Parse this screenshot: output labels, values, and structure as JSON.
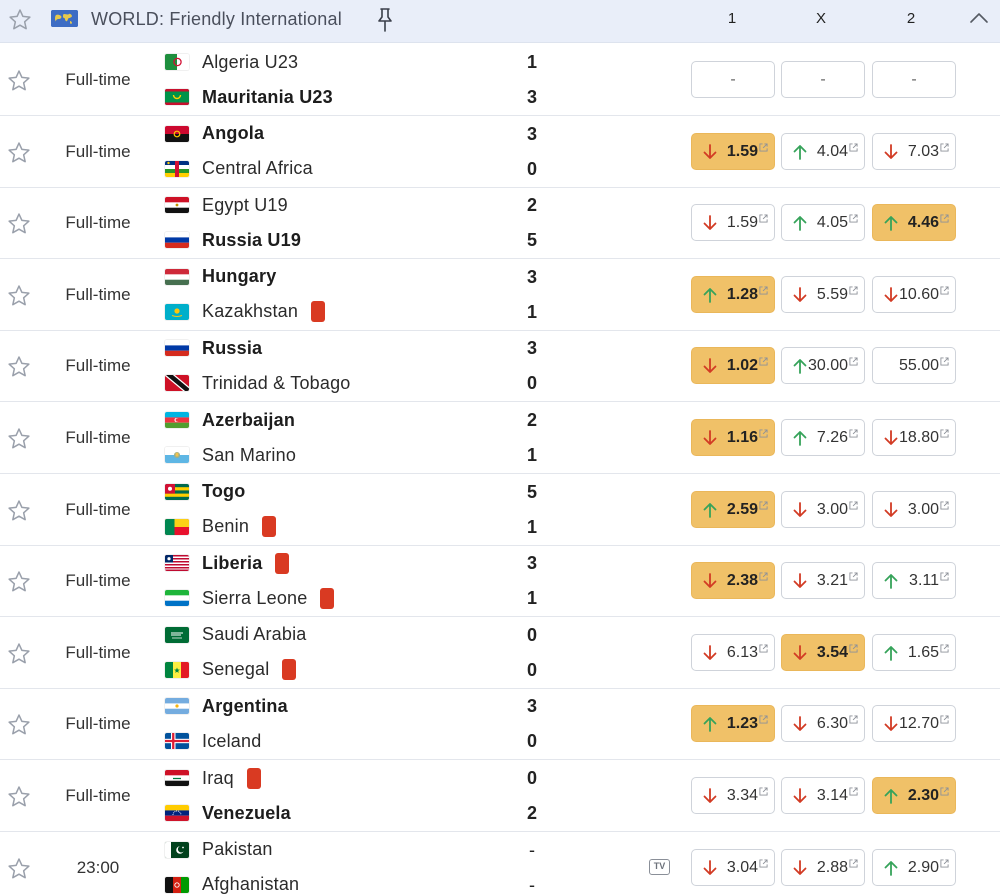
{
  "header": {
    "league": "WORLD: Friendly International",
    "col1": "1",
    "colX": "X",
    "col2": "2"
  },
  "colors": {
    "highlight": "#f0c168",
    "up": "#36a35a",
    "down": "#d23b24",
    "red_card": "#d93a22"
  },
  "matches": [
    {
      "status": "Full-time",
      "home": {
        "name": "Algeria U23",
        "flag": "algeria",
        "score": "1",
        "bold": false,
        "red_card": false
      },
      "away": {
        "name": "Mauritania U23",
        "flag": "mauritania",
        "score": "3",
        "bold": true,
        "red_card": false
      },
      "odds": [
        {
          "value": "-",
          "trend": "none",
          "highlight": false
        },
        {
          "value": "-",
          "trend": "none",
          "highlight": false
        },
        {
          "value": "-",
          "trend": "none",
          "highlight": false
        }
      ]
    },
    {
      "status": "Full-time",
      "home": {
        "name": "Angola",
        "flag": "angola",
        "score": "3",
        "bold": true,
        "red_card": false
      },
      "away": {
        "name": "Central Africa",
        "flag": "central-africa",
        "score": "0",
        "bold": false,
        "red_card": false
      },
      "odds": [
        {
          "value": "1.59",
          "trend": "down",
          "highlight": true
        },
        {
          "value": "4.04",
          "trend": "up",
          "highlight": false
        },
        {
          "value": "7.03",
          "trend": "down",
          "highlight": false
        }
      ]
    },
    {
      "status": "Full-time",
      "home": {
        "name": "Egypt U19",
        "flag": "egypt",
        "score": "2",
        "bold": false,
        "red_card": false
      },
      "away": {
        "name": "Russia U19",
        "flag": "russia",
        "score": "5",
        "bold": true,
        "red_card": false
      },
      "odds": [
        {
          "value": "1.59",
          "trend": "down",
          "highlight": false
        },
        {
          "value": "4.05",
          "trend": "up",
          "highlight": false
        },
        {
          "value": "4.46",
          "trend": "up",
          "highlight": true
        }
      ]
    },
    {
      "status": "Full-time",
      "home": {
        "name": "Hungary",
        "flag": "hungary",
        "score": "3",
        "bold": true,
        "red_card": false
      },
      "away": {
        "name": "Kazakhstan",
        "flag": "kazakhstan",
        "score": "1",
        "bold": false,
        "red_card": true
      },
      "odds": [
        {
          "value": "1.28",
          "trend": "up",
          "highlight": true
        },
        {
          "value": "5.59",
          "trend": "down",
          "highlight": false
        },
        {
          "value": "10.60",
          "trend": "down",
          "highlight": false
        }
      ]
    },
    {
      "status": "Full-time",
      "home": {
        "name": "Russia",
        "flag": "russia",
        "score": "3",
        "bold": true,
        "red_card": false
      },
      "away": {
        "name": "Trinidad & Tobago",
        "flag": "trinidad",
        "score": "0",
        "bold": false,
        "red_card": false
      },
      "odds": [
        {
          "value": "1.02",
          "trend": "down",
          "highlight": true
        },
        {
          "value": "30.00",
          "trend": "up",
          "highlight": false
        },
        {
          "value": "55.00",
          "trend": "none",
          "highlight": false
        }
      ]
    },
    {
      "status": "Full-time",
      "home": {
        "name": "Azerbaijan",
        "flag": "azerbaijan",
        "score": "2",
        "bold": true,
        "red_card": false
      },
      "away": {
        "name": "San Marino",
        "flag": "san-marino",
        "score": "1",
        "bold": false,
        "red_card": false
      },
      "odds": [
        {
          "value": "1.16",
          "trend": "down",
          "highlight": true
        },
        {
          "value": "7.26",
          "trend": "up",
          "highlight": false
        },
        {
          "value": "18.80",
          "trend": "down",
          "highlight": false
        }
      ]
    },
    {
      "status": "Full-time",
      "home": {
        "name": "Togo",
        "flag": "togo",
        "score": "5",
        "bold": true,
        "red_card": false
      },
      "away": {
        "name": "Benin",
        "flag": "benin",
        "score": "1",
        "bold": false,
        "red_card": true
      },
      "odds": [
        {
          "value": "2.59",
          "trend": "up",
          "highlight": true
        },
        {
          "value": "3.00",
          "trend": "down",
          "highlight": false
        },
        {
          "value": "3.00",
          "trend": "down",
          "highlight": false
        }
      ]
    },
    {
      "status": "Full-time",
      "home": {
        "name": "Liberia",
        "flag": "liberia",
        "score": "3",
        "bold": true,
        "red_card": true
      },
      "away": {
        "name": "Sierra Leone",
        "flag": "sierra-leone",
        "score": "1",
        "bold": false,
        "red_card": true
      },
      "odds": [
        {
          "value": "2.38",
          "trend": "down",
          "highlight": true
        },
        {
          "value": "3.21",
          "trend": "down",
          "highlight": false
        },
        {
          "value": "3.11",
          "trend": "up",
          "highlight": false
        }
      ]
    },
    {
      "status": "Full-time",
      "home": {
        "name": "Saudi Arabia",
        "flag": "saudi",
        "score": "0",
        "bold": false,
        "red_card": false
      },
      "away": {
        "name": "Senegal",
        "flag": "senegal",
        "score": "0",
        "bold": false,
        "red_card": true
      },
      "odds": [
        {
          "value": "6.13",
          "trend": "down",
          "highlight": false
        },
        {
          "value": "3.54",
          "trend": "down",
          "highlight": true
        },
        {
          "value": "1.65",
          "trend": "up",
          "highlight": false
        }
      ]
    },
    {
      "status": "Full-time",
      "home": {
        "name": "Argentina",
        "flag": "argentina",
        "score": "3",
        "bold": true,
        "red_card": false
      },
      "away": {
        "name": "Iceland",
        "flag": "iceland",
        "score": "0",
        "bold": false,
        "red_card": false
      },
      "odds": [
        {
          "value": "1.23",
          "trend": "up",
          "highlight": true
        },
        {
          "value": "6.30",
          "trend": "down",
          "highlight": false
        },
        {
          "value": "12.70",
          "trend": "down",
          "highlight": false
        }
      ]
    },
    {
      "status": "Full-time",
      "home": {
        "name": "Iraq",
        "flag": "iraq",
        "score": "0",
        "bold": false,
        "red_card": true
      },
      "away": {
        "name": "Venezuela",
        "flag": "venezuela",
        "score": "2",
        "bold": true,
        "red_card": false
      },
      "odds": [
        {
          "value": "3.34",
          "trend": "down",
          "highlight": false
        },
        {
          "value": "3.14",
          "trend": "down",
          "highlight": false
        },
        {
          "value": "2.30",
          "trend": "up",
          "highlight": true
        }
      ]
    },
    {
      "status": "23:00",
      "tv": "TV",
      "home": {
        "name": "Pakistan",
        "flag": "pakistan",
        "score": "-",
        "bold": false,
        "red_card": false
      },
      "away": {
        "name": "Afghanistan",
        "flag": "afghanistan",
        "score": "-",
        "bold": false,
        "red_card": false
      },
      "odds": [
        {
          "value": "3.04",
          "trend": "down",
          "highlight": false
        },
        {
          "value": "2.88",
          "trend": "down",
          "highlight": false
        },
        {
          "value": "2.90",
          "trend": "up",
          "highlight": false
        }
      ]
    }
  ]
}
